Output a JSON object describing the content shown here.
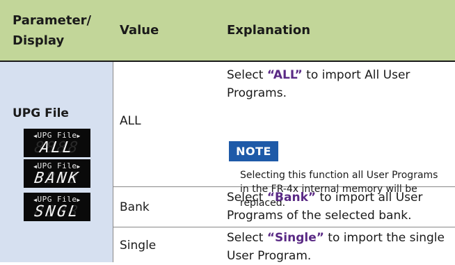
{
  "table": {
    "headers": {
      "parameter": "Parameter/ Display",
      "value": "Value",
      "explanation": "Explanation"
    },
    "parameter_label": "UPG File",
    "rows": [
      {
        "value": "ALL",
        "expl_pre": "Select ",
        "expl_key": "“ALL”",
        "expl_post": " to import All User Programs."
      },
      {
        "value": "Bank",
        "expl_pre": "Select ",
        "expl_key": "“Bank”",
        "expl_post": " to import all User Programs of the selected bank."
      },
      {
        "value": "Single",
        "expl_pre": "Select ",
        "expl_key": "“Single”",
        "expl_post": " to import the single User Program."
      }
    ],
    "note": {
      "badge": "NOTE",
      "text": "Selecting this function all User Programs in the FR-4x internal memory will be replaced."
    }
  },
  "displays": [
    {
      "line1": "UPG File",
      "line2": "ALL"
    },
    {
      "line1": "UPG File",
      "line2": "BANK"
    },
    {
      "line1": "UPG File",
      "line2": "SNGL"
    }
  ],
  "colors": {
    "header_bg": "#c2d699",
    "param_bg": "#d6e0f0",
    "keyword": "#5a2a85",
    "note_badge": "#1e5aa8"
  }
}
